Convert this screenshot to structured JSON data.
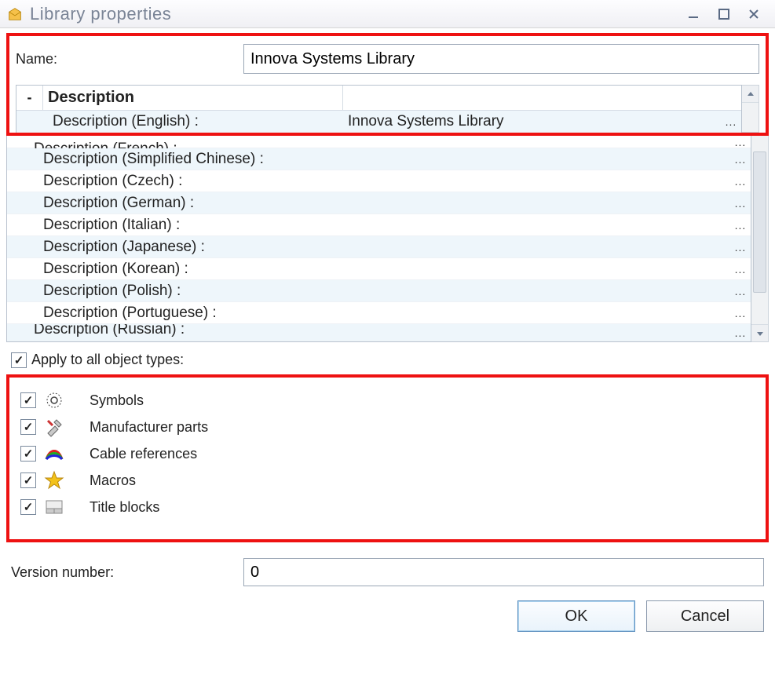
{
  "window": {
    "title": "Library properties"
  },
  "name": {
    "label": "Name:",
    "value": "Innova Systems Library"
  },
  "grid": {
    "header": "Description",
    "rows_top": [
      {
        "label": "Description (English) :",
        "value": "Innova Systems Library"
      }
    ],
    "rows_rest": [
      {
        "label": "Description (French) :",
        "value": ""
      },
      {
        "label": "Description (Simplified Chinese) :",
        "value": ""
      },
      {
        "label": "Description (Czech) :",
        "value": ""
      },
      {
        "label": "Description (German) :",
        "value": ""
      },
      {
        "label": "Description (Italian) :",
        "value": ""
      },
      {
        "label": "Description (Japanese) :",
        "value": ""
      },
      {
        "label": "Description (Korean) :",
        "value": ""
      },
      {
        "label": "Description (Polish) :",
        "value": ""
      },
      {
        "label": "Description (Portuguese) :",
        "value": ""
      },
      {
        "label": "Description (Russian) :",
        "value": ""
      }
    ]
  },
  "apply_all": {
    "label": "Apply to all object types:",
    "checked": true
  },
  "object_types": [
    {
      "id": "symbols",
      "label": "Symbols",
      "checked": true,
      "icon": "symbols-icon"
    },
    {
      "id": "manufacturer-parts",
      "label": "Manufacturer parts",
      "checked": true,
      "icon": "tools-icon"
    },
    {
      "id": "cable-references",
      "label": "Cable references",
      "checked": true,
      "icon": "cable-icon"
    },
    {
      "id": "macros",
      "label": "Macros",
      "checked": true,
      "icon": "star-icon"
    },
    {
      "id": "title-blocks",
      "label": "Title blocks",
      "checked": true,
      "icon": "titleblock-icon"
    }
  ],
  "version": {
    "label": "Version number:",
    "value": "0"
  },
  "buttons": {
    "ok": "OK",
    "cancel": "Cancel"
  },
  "glyphs": {
    "minus": "-",
    "check": "✓",
    "ellipsis": "..."
  }
}
